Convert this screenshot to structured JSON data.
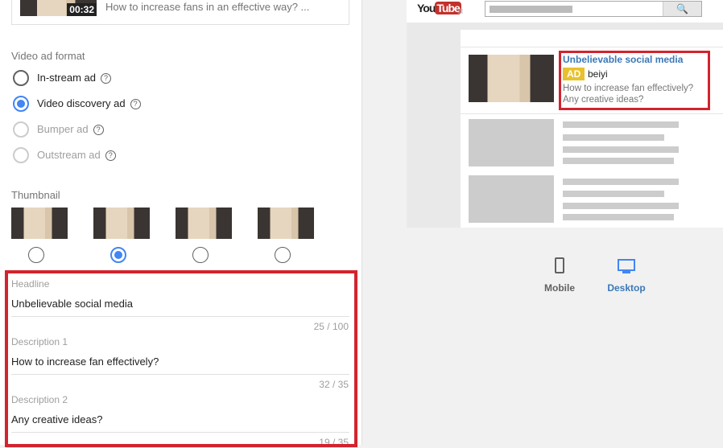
{
  "top_card": {
    "duration": "00:32",
    "description": "How to increase fans in an effective way? ..."
  },
  "format": {
    "label": "Video ad format",
    "options": [
      {
        "label": "In-stream ad",
        "selected": false,
        "disabled": false
      },
      {
        "label": "Video discovery ad",
        "selected": true,
        "disabled": false
      },
      {
        "label": "Bumper ad",
        "selected": false,
        "disabled": true
      },
      {
        "label": "Outstream ad",
        "selected": false,
        "disabled": true
      }
    ],
    "help": "?"
  },
  "thumbnail": {
    "label": "Thumbnail",
    "selected_index": 1
  },
  "fields": [
    {
      "label": "Headline",
      "value": "Unbelievable social media",
      "count": "25 / 100"
    },
    {
      "label": "Description 1",
      "value": "How to increase fan effectively?",
      "count": "32 / 35"
    },
    {
      "label": "Description 2",
      "value": "Any creative ideas?",
      "count": "19 / 35"
    }
  ],
  "preview": {
    "logo_you": "You",
    "logo_tube": "Tube",
    "ad_title": "Unbelievable social media",
    "ad_badge": "AD",
    "channel": "beiyi",
    "desc1": "How to increase fan effectively?",
    "desc2": "Any creative ideas?"
  },
  "devices": {
    "mobile": "Mobile",
    "desktop": "Desktop",
    "active": "Desktop"
  },
  "colors": {
    "accent": "#4285f4",
    "highlight": "#d3232d",
    "link": "#3b78b8",
    "badge": "#e8c12c"
  }
}
